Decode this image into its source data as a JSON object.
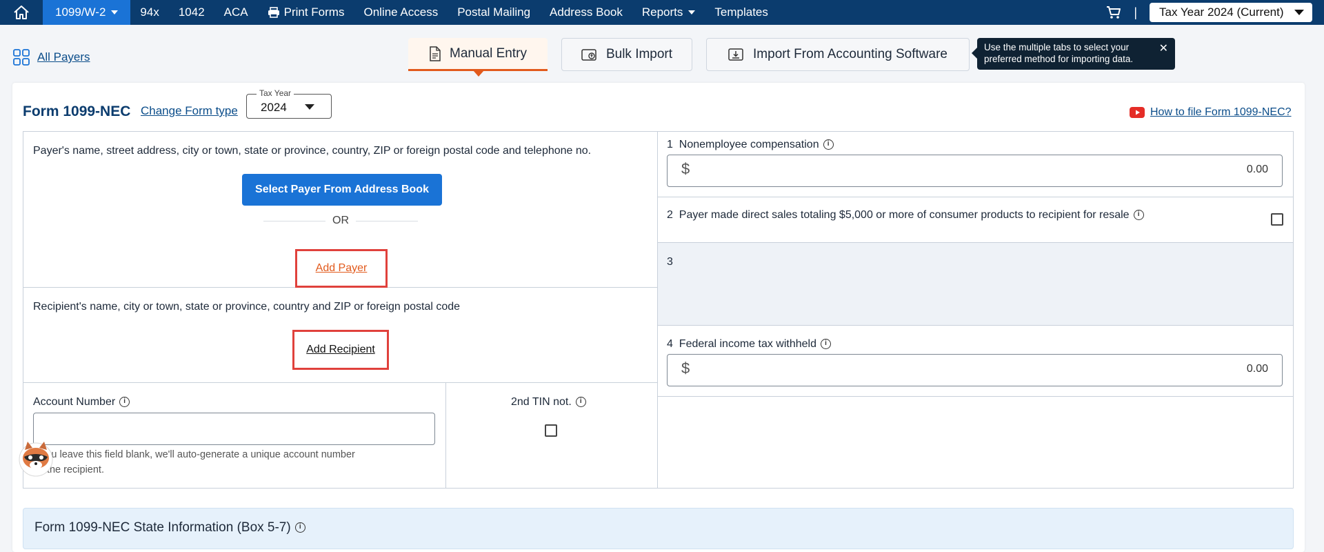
{
  "nav": {
    "items": [
      {
        "label": "1099/W-2",
        "active": true,
        "dropdown": true
      },
      {
        "label": "94x"
      },
      {
        "label": "1042"
      },
      {
        "label": "ACA"
      },
      {
        "label": "Print Forms",
        "icon": "printer-icon"
      },
      {
        "label": "Online Access"
      },
      {
        "label": "Postal Mailing"
      },
      {
        "label": "Address Book"
      },
      {
        "label": "Reports",
        "dropdown": true
      },
      {
        "label": "Templates"
      }
    ],
    "separator": "|",
    "tax_year": "Tax Year 2024 (Current)"
  },
  "subheader": {
    "all_payers": "All Payers",
    "tabs": [
      {
        "label": "Manual Entry",
        "icon": "document-icon",
        "active": true
      },
      {
        "label": "Bulk Import",
        "icon": "upload-file-icon"
      },
      {
        "label": "Import From Accounting Software",
        "icon": "import-icon"
      }
    ],
    "tooltip": "Use the multiple tabs to select your preferred method for importing data."
  },
  "form": {
    "title": "Form 1099-NEC",
    "change_form_type": "Change Form type",
    "tax_year_label": "Tax Year",
    "tax_year_value": "2024",
    "how_to": "How to file Form 1099-NEC?",
    "payer_label": "Payer's name, street address, city or town, state or province, country, ZIP or foreign postal code and telephone no.",
    "select_payer": "Select Payer From Address Book",
    "or": "OR",
    "add_payer": "Add Payer",
    "recipient_label": "Recipient's name, city or town, state or province, country and ZIP or foreign postal code",
    "add_recipient": "Add Recipient",
    "account_number_label": "Account Number",
    "account_number_value": "",
    "account_helper": "If you leave this field blank, we'll auto-generate a unique account number for the recipient.",
    "second_tin": "2nd TIN not.",
    "box1_num": "1",
    "box1_label": "Nonemployee compensation",
    "box1_currency": "$",
    "box1_value": "0.00",
    "box2_num": "2",
    "box2_label": "Payer made direct sales totaling $5,000 or more of consumer products to recipient for resale",
    "box3_num": "3",
    "box4_num": "4",
    "box4_label": "Federal income tax withheld",
    "box4_currency": "$",
    "box4_value": "0.00",
    "state_info": "Form 1099-NEC  State Information  (Box 5-7)"
  },
  "colors": {
    "nav_bg": "#0b3c6e",
    "accent": "#1a73d6",
    "highlight": "#e0413c",
    "tab_accent": "#e25a1c"
  }
}
